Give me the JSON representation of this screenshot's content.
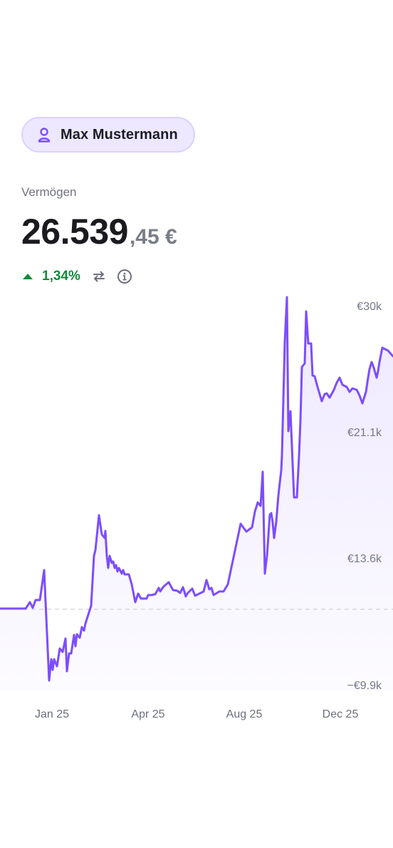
{
  "profile": {
    "name": "Max Mustermann",
    "icon": "user-icon"
  },
  "portfolio": {
    "label": "Vermögen",
    "value_main": "26.539",
    "value_decimal": ",45 €",
    "change_pct": "1,34%",
    "change_direction": "up"
  },
  "colors": {
    "accent": "#7c4dff",
    "positive": "#128a3a",
    "chip_bg": "#ede8ff"
  },
  "chart_data": {
    "type": "area",
    "y_ticks": [
      "€30k",
      "€21.1k",
      "€13.6k",
      "−€9.9k"
    ],
    "x_ticks": [
      "Jan 25",
      "Apr 25",
      "Aug 25",
      "Dec 25"
    ],
    "baseline_dashed": true,
    "points": [
      [
        0,
        854
      ],
      [
        36,
        854
      ],
      [
        42,
        845
      ],
      [
        46,
        853
      ],
      [
        50,
        842
      ],
      [
        56,
        842
      ],
      [
        62,
        800
      ],
      [
        69,
        955
      ],
      [
        72,
        925
      ],
      [
        74,
        940
      ],
      [
        76,
        925
      ],
      [
        80,
        935
      ],
      [
        84,
        910
      ],
      [
        88,
        915
      ],
      [
        92,
        896
      ],
      [
        94,
        942
      ],
      [
        97,
        917
      ],
      [
        100,
        917
      ],
      [
        104,
        891
      ],
      [
        106,
        907
      ],
      [
        108,
        890
      ],
      [
        112,
        895
      ],
      [
        115,
        880
      ],
      [
        118,
        885
      ],
      [
        120,
        875
      ],
      [
        128,
        850
      ],
      [
        132,
        780
      ],
      [
        134,
        772
      ],
      [
        139,
        723
      ],
      [
        143,
        750
      ],
      [
        147,
        755
      ],
      [
        148,
        745
      ],
      [
        150,
        780
      ],
      [
        152,
        797
      ],
      [
        154,
        780
      ],
      [
        157,
        790
      ],
      [
        159,
        788
      ],
      [
        161,
        797
      ],
      [
        163,
        793
      ],
      [
        165,
        802
      ],
      [
        167,
        797
      ],
      [
        169,
        801
      ],
      [
        171,
        805
      ],
      [
        173,
        800
      ],
      [
        175,
        806
      ],
      [
        181,
        806
      ],
      [
        185,
        820
      ],
      [
        190,
        845
      ],
      [
        194,
        833
      ],
      [
        198,
        840
      ],
      [
        206,
        840
      ],
      [
        208,
        835
      ],
      [
        214,
        835
      ],
      [
        216,
        834
      ],
      [
        218,
        834
      ],
      [
        223,
        825
      ],
      [
        225,
        830
      ],
      [
        229,
        824
      ],
      [
        231,
        822
      ],
      [
        237,
        817
      ],
      [
        243,
        828
      ],
      [
        249,
        829
      ],
      [
        253,
        832
      ],
      [
        257,
        824
      ],
      [
        261,
        837
      ],
      [
        263,
        833
      ],
      [
        266,
        830
      ],
      [
        270,
        826
      ],
      [
        274,
        836
      ],
      [
        286,
        830
      ],
      [
        290,
        814
      ],
      [
        294,
        827
      ],
      [
        297,
        825
      ],
      [
        300,
        835
      ],
      [
        308,
        830
      ],
      [
        314,
        830
      ],
      [
        320,
        820
      ],
      [
        338,
        735
      ],
      [
        346,
        746
      ],
      [
        354,
        740
      ],
      [
        358,
        718
      ],
      [
        362,
        705
      ],
      [
        366,
        710
      ],
      [
        369,
        662
      ],
      [
        372,
        805
      ],
      [
        375,
        780
      ],
      [
        379,
        722
      ],
      [
        381,
        720
      ],
      [
        383,
        733
      ],
      [
        385,
        755
      ],
      [
        388,
        732
      ],
      [
        391,
        695
      ],
      [
        395,
        660
      ],
      [
        396,
        640
      ],
      [
        400,
        480
      ],
      [
        403,
        417
      ],
      [
        405,
        605
      ],
      [
        408,
        577
      ],
      [
        411,
        650
      ],
      [
        413,
        698
      ],
      [
        417,
        698
      ],
      [
        420,
        640
      ],
      [
        422,
        590
      ],
      [
        424,
        515
      ],
      [
        428,
        510
      ],
      [
        430,
        437
      ],
      [
        433,
        482
      ],
      [
        437,
        482
      ],
      [
        439,
        527
      ],
      [
        442,
        528
      ],
      [
        446,
        543
      ],
      [
        452,
        563
      ],
      [
        456,
        553
      ],
      [
        459,
        552
      ],
      [
        463,
        558
      ],
      [
        469,
        547
      ],
      [
        473,
        537
      ],
      [
        477,
        530
      ],
      [
        481,
        540
      ],
      [
        487,
        543
      ],
      [
        491,
        550
      ],
      [
        495,
        545
      ],
      [
        501,
        547
      ],
      [
        505,
        555
      ],
      [
        509,
        566
      ],
      [
        514,
        550
      ],
      [
        517,
        530
      ],
      [
        519,
        518
      ],
      [
        522,
        508
      ],
      [
        525,
        516
      ],
      [
        529,
        530
      ],
      [
        531,
        521
      ],
      [
        533,
        508
      ],
      [
        537,
        488
      ],
      [
        545,
        492
      ],
      [
        552,
        500
      ]
    ]
  }
}
